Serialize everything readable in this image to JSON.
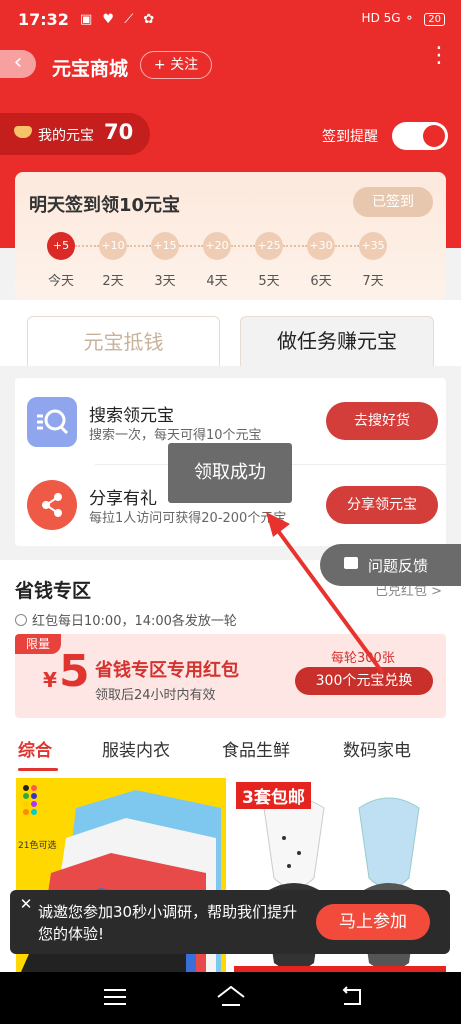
{
  "status_bar": {
    "time": "17:32",
    "icons": "▣ ♥ ⟋ ✿",
    "network": "HD 5G ⚬",
    "battery": "20"
  },
  "header": {
    "back": "‹",
    "title": "元宝商城",
    "follow": "+ 关注",
    "more": "⋮"
  },
  "coins": {
    "label": "我的元宝",
    "count": "70"
  },
  "remind": {
    "label": "签到提醒",
    "enabled": true
  },
  "sign": {
    "title": "明天签到领10元宝",
    "button": "已签到",
    "days": [
      {
        "bonus": "+5",
        "label": "今天",
        "active": true
      },
      {
        "bonus": "+10",
        "label": "2天",
        "active": false
      },
      {
        "bonus": "+15",
        "label": "3天",
        "active": false
      },
      {
        "bonus": "+20",
        "label": "4天",
        "active": false
      },
      {
        "bonus": "+25",
        "label": "5天",
        "active": false
      },
      {
        "bonus": "+30",
        "label": "6天",
        "active": false
      },
      {
        "bonus": "+35",
        "label": "7天",
        "active": false
      }
    ]
  },
  "tabs": {
    "left": "元宝抵钱",
    "right": "做任务赚元宝"
  },
  "tasks": [
    {
      "title": "搜索领元宝",
      "desc": "搜索一次，每天可得10个元宝",
      "button": "去搜好货"
    },
    {
      "title": "分享有礼",
      "desc": "每拉1人访问可获得20-200个元宝",
      "button": "分享领元宝"
    }
  ],
  "toast": "领取成功",
  "feedback": "问题反馈",
  "savings": {
    "title": "省钱专区",
    "link": "已兑红包 >",
    "subtitle": "红包每日10:00，14:00各发放一轮",
    "coupon": {
      "badge": "限量",
      "yen": "¥",
      "amount": "5",
      "title": "省钱专区专用红包",
      "sub": "领取后24小时内有效",
      "limit": "每轮300张",
      "button": "300个元宝兑换"
    }
  },
  "categories": [
    "综合",
    "服装内衣",
    "食品生鲜",
    "数码家电"
  ],
  "products": {
    "p1_note": "21色可选",
    "p2_badge": "3套包邮"
  },
  "survey": {
    "close": "✕",
    "text": "诚邀您参加30秒小调研，帮助我们提升您的体验!",
    "button": "马上参加"
  },
  "colors": {
    "brand_red": "#ea2d2a",
    "button_red": "#d33d3a",
    "toast_gray": "#6b6b6b"
  }
}
